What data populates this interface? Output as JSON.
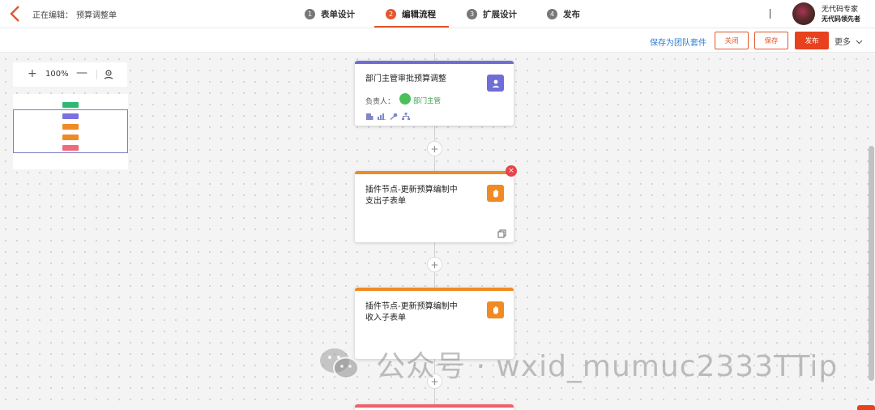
{
  "header": {
    "editing_label": "正在编辑：",
    "doc_title": "预算调整单",
    "steps": [
      {
        "num": "1",
        "label": "表单设计"
      },
      {
        "num": "2",
        "label": "编辑流程"
      },
      {
        "num": "3",
        "label": "扩展设计"
      },
      {
        "num": "4",
        "label": "发布"
      }
    ],
    "active_step": 2,
    "user_name": "无代码专家",
    "user_sub": "无代码领先者"
  },
  "actionbar": {
    "save_team": "保存为团队套件",
    "close": "关闭",
    "save": "保存",
    "publish": "发布",
    "more": "更多"
  },
  "zoom": {
    "value": "100%",
    "plus": "+",
    "minus": "—"
  },
  "minimap": {
    "nodes": [
      "#2eb872",
      "#7c6fe0",
      "#f08a24",
      "#f08a24",
      "#f06a7a"
    ]
  },
  "nodes": [
    {
      "title": "部门主管审批预算调整",
      "owner_label": "负责人：",
      "owner_name": "部门主管",
      "color": "#6f6ed8"
    },
    {
      "title_line1": "插件节点-更新预算编制中",
      "title_line2": "支出子表单",
      "color": "#f08a24"
    },
    {
      "title_line1": "插件节点-更新预算编制中",
      "title_line2": "收入子表单",
      "color": "#f08a24"
    }
  ],
  "add_symbol": "+",
  "delete_symbol": "×",
  "watermark": "公众号 · wxid_mumuc2333TTip",
  "colors": {
    "accent": "#e4572e",
    "publish": "#e8411e",
    "link": "#2b7fd8"
  }
}
